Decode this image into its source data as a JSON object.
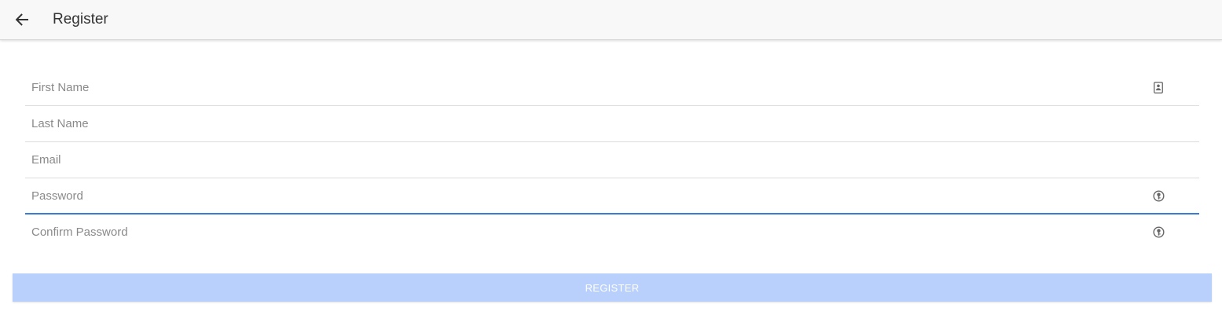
{
  "toolbar": {
    "title": "Register",
    "back_icon": "arrow-back-icon"
  },
  "form": {
    "fields": [
      {
        "placeholder": "First Name",
        "value": "",
        "icon": "contact-card-icon"
      },
      {
        "placeholder": "Last Name",
        "value": ""
      },
      {
        "placeholder": "Email",
        "value": ""
      },
      {
        "placeholder": "Password",
        "value": "",
        "icon": "key-icon",
        "focused": true
      },
      {
        "placeholder": "Confirm Password",
        "value": "",
        "icon": "key-icon"
      }
    ],
    "submit_label": "REGISTER"
  },
  "colors": {
    "toolbar_bg": "#f8f8f8",
    "focus_underline": "#3b7bd8",
    "button_disabled_bg": "#b8d0fb"
  }
}
